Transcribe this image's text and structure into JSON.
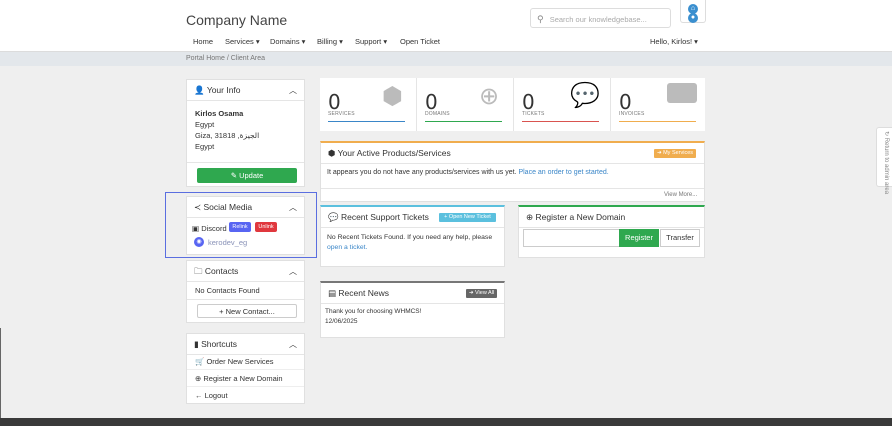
{
  "header": {
    "company": "Company Name",
    "search_placeholder": "Search our knowledgebase...",
    "nav": [
      "Home",
      "Services ▾",
      "Domains ▾",
      "Billing ▾",
      "Support ▾",
      "Open Ticket"
    ],
    "greeting": "Hello, Kirlos! ▾",
    "breadcrumb": "Portal Home / Client Area"
  },
  "sidebar": {
    "your_info": {
      "title": "Your Info",
      "name": "Kirlos Osama",
      "line1": "Egypt",
      "line2": "Giza, 31818 ,الجيزة",
      "line3": "Egypt",
      "update": "Update"
    },
    "social": {
      "title": "Social Media",
      "discord": "Discord",
      "relink": "Relink",
      "unlink": "Unlink",
      "username": "kerodev_eg"
    },
    "contacts": {
      "title": "Contacts",
      "empty": "No Contacts Found",
      "new": "+ New Contact..."
    },
    "shortcuts": {
      "title": "Shortcuts",
      "items": [
        "Order New Services",
        "Register a New Domain",
        "Logout"
      ]
    }
  },
  "stats": [
    {
      "value": "0",
      "label": "SERVICES",
      "color": "#3a86c8"
    },
    {
      "value": "0",
      "label": "DOMAINS",
      "color": "#2fa84f"
    },
    {
      "value": "0",
      "label": "TICKETS",
      "color": "#d9534f"
    },
    {
      "value": "0",
      "label": "INVOICES",
      "color": "#f0ad4e"
    }
  ],
  "products": {
    "title": "Your Active Products/Services",
    "badge": "My Services",
    "text": "It appears you do not have any products/services with us yet.",
    "link": "Place an order to get started.",
    "more": "View More..."
  },
  "tickets": {
    "title": "Recent Support Tickets",
    "button": "Open New Ticket",
    "text": "No Recent Tickets Found. If you need any help, please",
    "link": "open a ticket."
  },
  "domain": {
    "title": "Register a New Domain",
    "register": "Register",
    "transfer": "Transfer"
  },
  "news": {
    "title": "Recent News",
    "button": "View All",
    "item": "Thank you for choosing WHMCS!",
    "date": "12/06/2025"
  },
  "admin_tab": "Return to admin area"
}
